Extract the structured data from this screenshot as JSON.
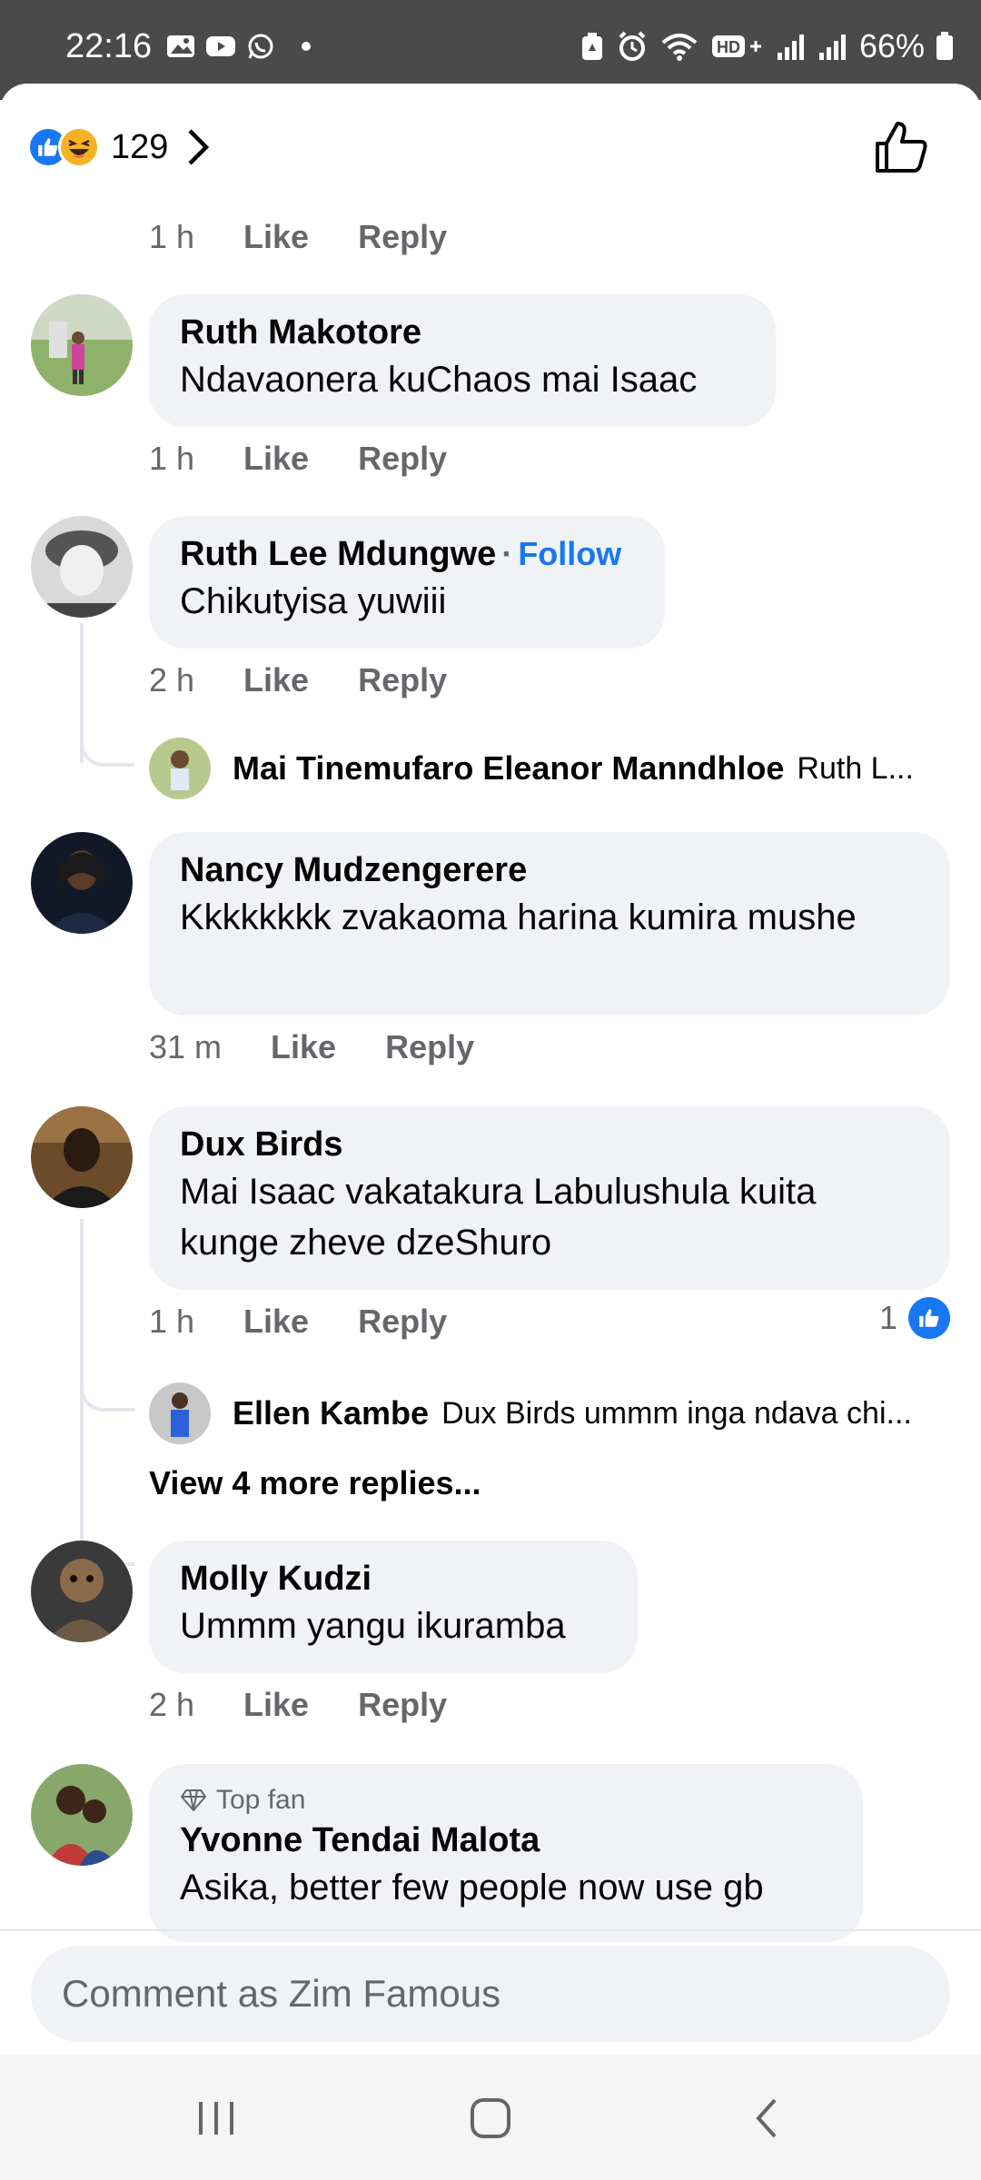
{
  "status_bar": {
    "time": "22:16",
    "battery": "66%"
  },
  "header": {
    "reaction_count": "129"
  },
  "action_labels": {
    "like": "Like",
    "reply": "Reply"
  },
  "top_meta": {
    "time": "1 h"
  },
  "comments": [
    {
      "name": "Ruth Makotore",
      "text": "Ndavaonera kuChaos mai Isaac",
      "time": "1 h"
    },
    {
      "name": "Ruth Lee Mdungwe",
      "follow": "Follow",
      "text": "Chikutyisa yuwiii",
      "time": "2 h",
      "reply_preview": {
        "name": "Mai Tinemufaro  Eleanor  Manndhloe",
        "text": "Ruth L..."
      }
    },
    {
      "name": "Nancy Mudzengerere",
      "text": "Kkkkkkkk zvakaoma harina kumira mushe",
      "time": "31 m"
    },
    {
      "name": "Dux Birds",
      "text": "Mai Isaac vakatakura Labulushula kuita kunge zheve dzeShuro",
      "time": "1 h",
      "like_count": "1",
      "reply_preview": {
        "name": "Ellen Kambe",
        "text": "Dux Birds ummm inga ndava chi..."
      },
      "view_more": "View 4 more replies..."
    },
    {
      "name": "Molly Kudzi",
      "text": "Ummm yangu ikuramba",
      "time": "2 h"
    },
    {
      "badge": "Top fan",
      "name": "Yvonne Tendai Malota",
      "text": "Asika, better few people now use gb"
    }
  ],
  "composer": {
    "placeholder": "Comment as Zim Famous"
  },
  "colors": {
    "accent": "#1877f2",
    "bubble": "#f0f2f5",
    "muted": "#65676b",
    "status_bar": "#4a4a4a"
  }
}
